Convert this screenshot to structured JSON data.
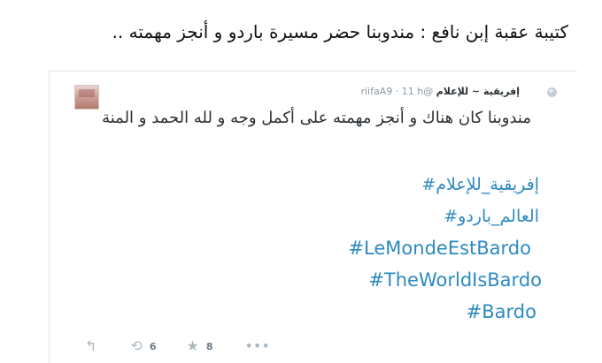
{
  "caption": "كتيبة عقبة إبن نافع : مندوبنا حضر مسيرة باردو و أنجز مهمته ..",
  "tweet": {
    "author_name": "إفريقية ~ للإعلام",
    "handle": "@riifaA9",
    "separator": "·",
    "time": "11 h",
    "text": "مندوبنا كان هناك و أنجز مهمته على أكمل وجه و لله الحمد و المنة",
    "hashtags": [
      "#إفريقية_للإعلام",
      "#العالم_باردو",
      "#LeMondeEstBardo",
      "#TheWorldIsBardo",
      "#Bardo"
    ]
  },
  "actions": {
    "reply_icon": "reply-icon",
    "retweet_icon": "retweet-icon",
    "retweet_count": "6",
    "favorite_icon": "star-icon",
    "favorite_count": "8",
    "more_icon": "more-icon"
  },
  "colors": {
    "hashtag": "#2c8ac0",
    "muted": "#aab8c2",
    "text": "#292f33"
  }
}
